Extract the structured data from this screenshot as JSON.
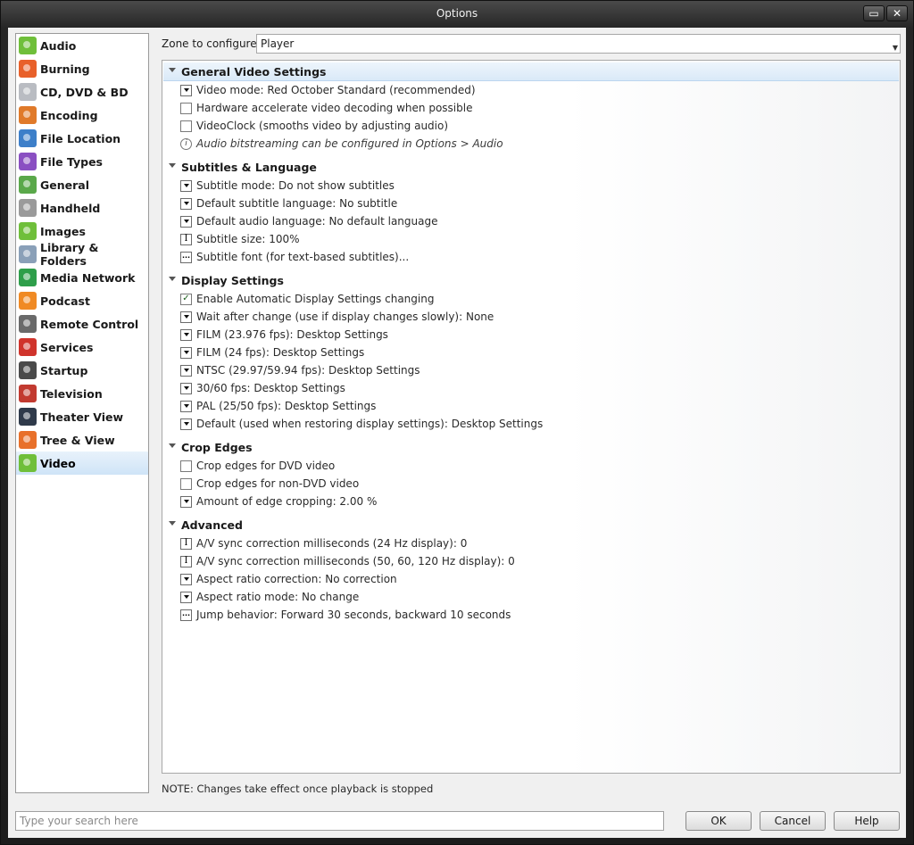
{
  "window": {
    "title": "Options"
  },
  "sidebar": {
    "items": [
      {
        "label": "Audio",
        "icon": "audio-icon",
        "color": "#6fbf3a"
      },
      {
        "label": "Burning",
        "icon": "burning-icon",
        "color": "#e8602a"
      },
      {
        "label": "CD, DVD & BD",
        "icon": "disc-icon",
        "color": "#b9bcc2"
      },
      {
        "label": "Encoding",
        "icon": "encoding-icon",
        "color": "#e07a2a"
      },
      {
        "label": "File Location",
        "icon": "globe-icon",
        "color": "#3d7fc9"
      },
      {
        "label": "File Types",
        "icon": "puzzle-icon",
        "color": "#8a4fc2"
      },
      {
        "label": "General",
        "icon": "general-icon",
        "color": "#5aa84a"
      },
      {
        "label": "Handheld",
        "icon": "handheld-icon",
        "color": "#9a9a9a"
      },
      {
        "label": "Images",
        "icon": "images-icon",
        "color": "#6fbf3a"
      },
      {
        "label": "Library & Folders",
        "icon": "library-icon",
        "color": "#8aa0b8"
      },
      {
        "label": "Media Network",
        "icon": "network-icon",
        "color": "#2e9e4a"
      },
      {
        "label": "Podcast",
        "icon": "rss-icon",
        "color": "#f08a24"
      },
      {
        "label": "Remote Control",
        "icon": "remote-icon",
        "color": "#6a6a6a"
      },
      {
        "label": "Services",
        "icon": "services-icon",
        "color": "#d0342c"
      },
      {
        "label": "Startup",
        "icon": "startup-icon",
        "color": "#4a4a4a"
      },
      {
        "label": "Television",
        "icon": "television-icon",
        "color": "#c23a30"
      },
      {
        "label": "Theater View",
        "icon": "theater-view-icon",
        "color": "#2f3a4a"
      },
      {
        "label": "Tree & View",
        "icon": "tree-view-icon",
        "color": "#e8702a"
      },
      {
        "label": "Video",
        "icon": "video-icon",
        "color": "#6fbf3a",
        "selected": true
      }
    ]
  },
  "zone": {
    "label": "Zone to configure:",
    "value": "Player"
  },
  "sections": [
    {
      "title": "General Video Settings",
      "items": [
        {
          "type": "dropdown",
          "label": "Video mode: Red October Standard (recommended)"
        },
        {
          "type": "checkbox",
          "checked": false,
          "label": "Hardware accelerate video decoding when possible"
        },
        {
          "type": "checkbox",
          "checked": false,
          "label": "VideoClock (smooths video by adjusting audio)"
        },
        {
          "type": "info",
          "label": "Audio bitstreaming can be configured in Options > Audio"
        }
      ]
    },
    {
      "title": "Subtitles & Language",
      "items": [
        {
          "type": "dropdown",
          "label": "Subtitle mode: Do not show subtitles"
        },
        {
          "type": "dropdown",
          "label": "Default subtitle language: No subtitle"
        },
        {
          "type": "dropdown",
          "label": "Default audio language: No default language"
        },
        {
          "type": "text",
          "label": "Subtitle size: 100%"
        },
        {
          "type": "ellipsis",
          "label": "Subtitle font (for text-based subtitles)..."
        }
      ]
    },
    {
      "title": "Display Settings",
      "items": [
        {
          "type": "checkbox",
          "checked": true,
          "label": "Enable Automatic Display Settings changing"
        },
        {
          "type": "dropdown",
          "label": "Wait after change (use if display changes slowly): None"
        },
        {
          "type": "dropdown",
          "label": "FILM (23.976 fps): Desktop Settings"
        },
        {
          "type": "dropdown",
          "label": "FILM (24 fps): Desktop Settings"
        },
        {
          "type": "dropdown",
          "label": "NTSC (29.97/59.94 fps): Desktop Settings"
        },
        {
          "type": "dropdown",
          "label": "30/60 fps: Desktop Settings"
        },
        {
          "type": "dropdown",
          "label": "PAL (25/50 fps): Desktop Settings"
        },
        {
          "type": "dropdown",
          "label": "Default (used when restoring display settings): Desktop Settings"
        }
      ]
    },
    {
      "title": "Crop Edges",
      "items": [
        {
          "type": "checkbox",
          "checked": false,
          "label": "Crop edges for DVD video"
        },
        {
          "type": "checkbox",
          "checked": false,
          "label": "Crop edges for non-DVD video"
        },
        {
          "type": "dropdown",
          "label": "Amount of edge cropping: 2.00 %"
        }
      ]
    },
    {
      "title": "Advanced",
      "items": [
        {
          "type": "text",
          "label": "A/V sync correction milliseconds (24 Hz display): 0"
        },
        {
          "type": "text",
          "label": "A/V sync correction milliseconds (50, 60, 120 Hz display): 0"
        },
        {
          "type": "dropdown",
          "label": "Aspect ratio correction: No correction"
        },
        {
          "type": "dropdown",
          "label": "Aspect ratio mode: No change"
        },
        {
          "type": "ellipsis",
          "label": "Jump behavior: Forward 30 seconds, backward 10 seconds"
        }
      ]
    }
  ],
  "note": "NOTE: Changes take effect once playback is stopped",
  "search": {
    "placeholder": "Type your search here",
    "value": ""
  },
  "buttons": {
    "ok": "OK",
    "cancel": "Cancel",
    "help": "Help"
  }
}
